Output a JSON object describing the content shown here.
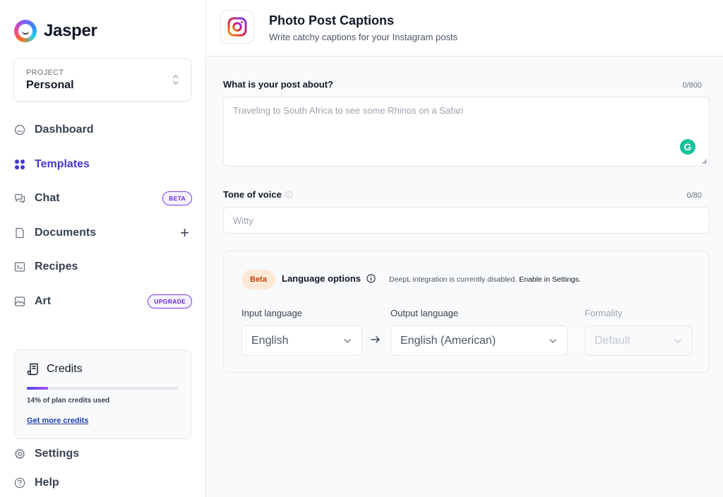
{
  "app": {
    "name": "Jasper"
  },
  "project": {
    "label": "PROJECT",
    "value": "Personal"
  },
  "nav": {
    "dashboard": "Dashboard",
    "templates": "Templates",
    "chat": "Chat",
    "chat_badge": "BETA",
    "documents": "Documents",
    "documents_add": "+",
    "recipes": "Recipes",
    "art": "Art",
    "art_badge": "UPGRADE"
  },
  "credits": {
    "title": "Credits",
    "used_percent": 14,
    "used_text": "14% of plan credits used",
    "link": "Get more credits"
  },
  "bottom_nav": {
    "settings": "Settings",
    "help": "Help"
  },
  "template": {
    "title": "Photo Post Captions",
    "subtitle": "Write catchy captions for your Instagram posts"
  },
  "form": {
    "post_about": {
      "label": "What is your post about?",
      "count": "0/800",
      "placeholder": "Traveling to South Africa to see some Rhinos on a Safari"
    },
    "tone": {
      "label": "Tone of voice",
      "count": "0/80",
      "placeholder": "Witty"
    }
  },
  "language": {
    "badge": "Beta",
    "title": "Language options",
    "note": "DeepL integration is currently disabled.",
    "note_link": "Enable in Settings.",
    "input_label": "Input language",
    "input_value": "English",
    "output_label": "Output language",
    "output_value": "English (American)",
    "formality_label": "Formality",
    "formality_value": "Default"
  },
  "colors": {
    "accent": "#4338ca",
    "grammarly": "#15c39a",
    "beta_bg": "#fde9d6",
    "badge_purple": "#7c3aed"
  }
}
